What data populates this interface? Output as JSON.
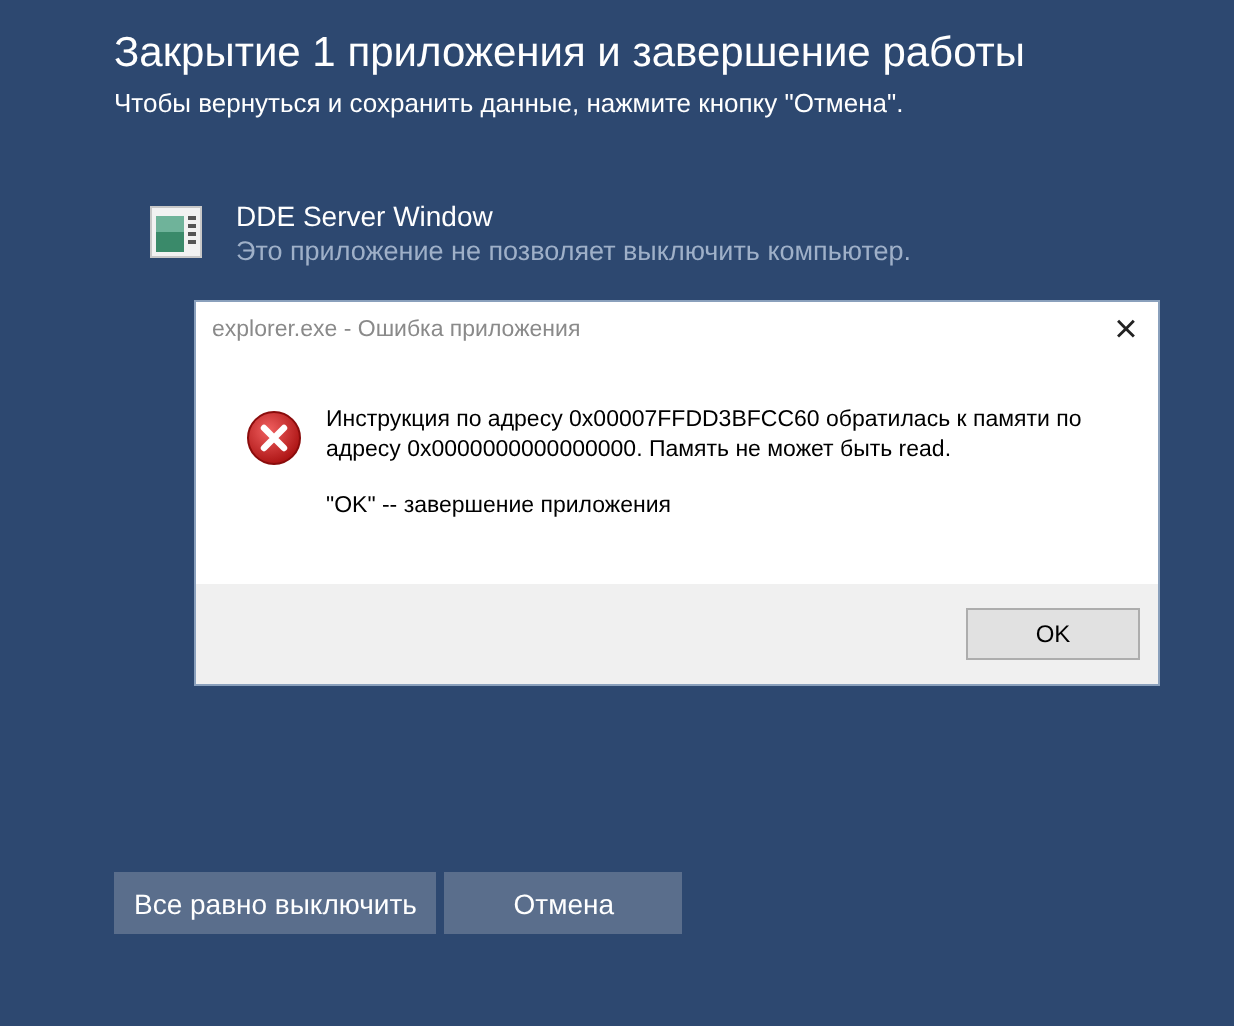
{
  "screen": {
    "title": "Закрытие 1 приложения и завершение работы",
    "subtitle": "Чтобы вернуться и сохранить данные, нажмите кнопку \"Отмена\"."
  },
  "apps": [
    {
      "name": "DDE Server Window",
      "status": "Это приложение не позволяет выключить компьютер."
    }
  ],
  "dialog": {
    "title": "explorer.exe - Ошибка приложения",
    "close": "×",
    "message": "Инструкция по адресу 0x00007FFDD3BFCC60 обратилась к памяти по адресу 0x0000000000000000. Память не может быть read.",
    "hint": "\"OK\" -- завершение приложения",
    "button": "OK"
  },
  "buttons": [
    {
      "label": "Все равно выключить"
    },
    {
      "label": "Отмена"
    }
  ]
}
